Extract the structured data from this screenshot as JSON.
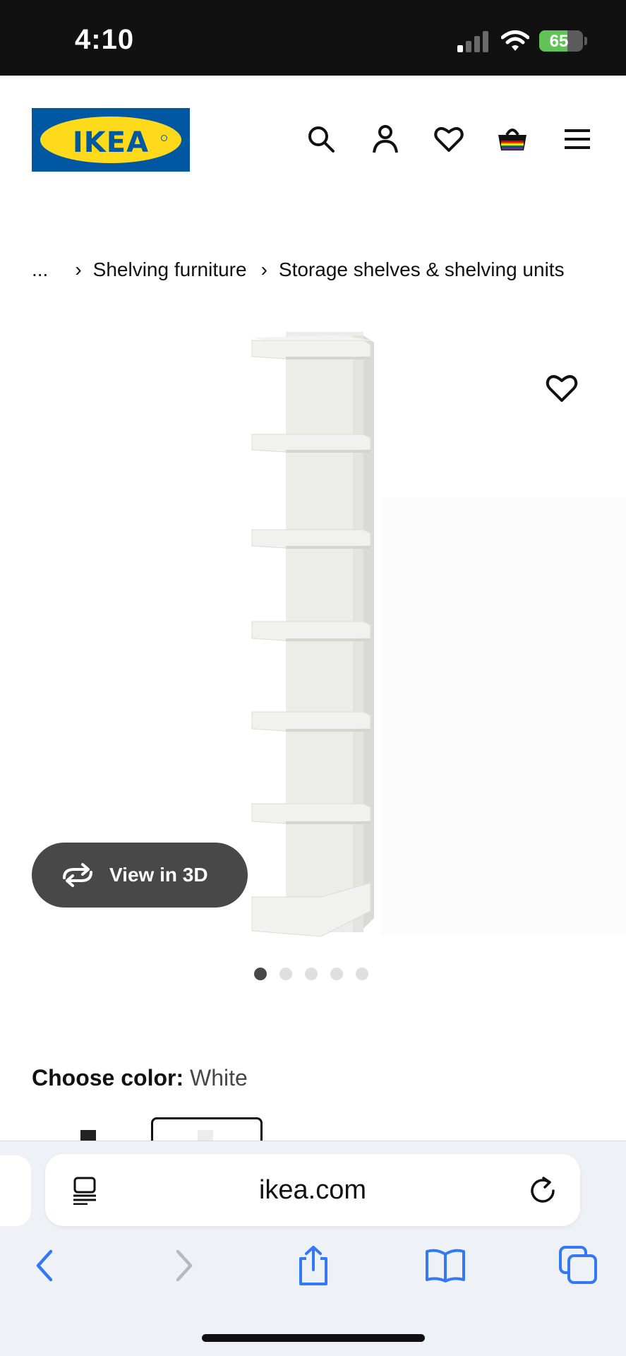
{
  "status_bar": {
    "time": "4:10",
    "battery": "65",
    "icons": [
      "cellular-signal-icon",
      "wifi-icon",
      "battery-charging-icon"
    ]
  },
  "header": {
    "logo_text": "IKEA",
    "icons": [
      "search-icon",
      "account-icon",
      "heart-icon",
      "shopping-bag-icon",
      "menu-icon"
    ]
  },
  "breadcrumb": {
    "ellipsis": "...",
    "items": [
      "Shelving furniture",
      "Storage shelves & shelving units"
    ]
  },
  "product": {
    "view3d_label": "View in 3D",
    "image_count": 5,
    "active_image": 1
  },
  "color": {
    "label": "Choose color:",
    "value": "White"
  },
  "browser": {
    "url": "ikea.com",
    "toolbar": [
      "back-icon",
      "forward-icon",
      "share-icon",
      "bookmarks-icon",
      "tabs-icon"
    ]
  },
  "colors": {
    "ikea_blue": "#0058a3",
    "ikea_yellow": "#ffda1a",
    "safari_blue": "#3478f6",
    "pill_dark": "#484848"
  }
}
